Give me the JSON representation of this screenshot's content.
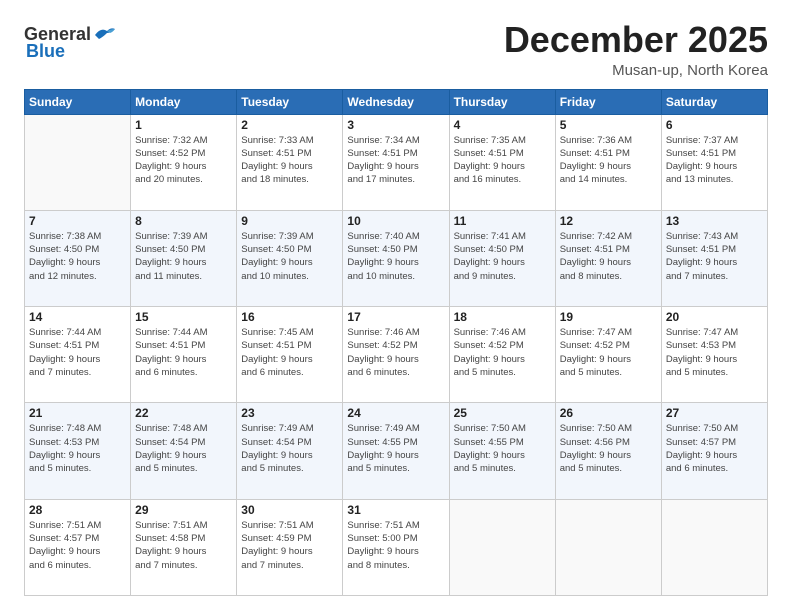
{
  "logo": {
    "general": "General",
    "blue": "Blue"
  },
  "header": {
    "month_title": "December 2025",
    "subtitle": "Musan-up, North Korea"
  },
  "days_of_week": [
    "Sunday",
    "Monday",
    "Tuesday",
    "Wednesday",
    "Thursday",
    "Friday",
    "Saturday"
  ],
  "weeks": [
    [
      {
        "day": "",
        "info": ""
      },
      {
        "day": "1",
        "info": "Sunrise: 7:32 AM\nSunset: 4:52 PM\nDaylight: 9 hours\nand 20 minutes."
      },
      {
        "day": "2",
        "info": "Sunrise: 7:33 AM\nSunset: 4:51 PM\nDaylight: 9 hours\nand 18 minutes."
      },
      {
        "day": "3",
        "info": "Sunrise: 7:34 AM\nSunset: 4:51 PM\nDaylight: 9 hours\nand 17 minutes."
      },
      {
        "day": "4",
        "info": "Sunrise: 7:35 AM\nSunset: 4:51 PM\nDaylight: 9 hours\nand 16 minutes."
      },
      {
        "day": "5",
        "info": "Sunrise: 7:36 AM\nSunset: 4:51 PM\nDaylight: 9 hours\nand 14 minutes."
      },
      {
        "day": "6",
        "info": "Sunrise: 7:37 AM\nSunset: 4:51 PM\nDaylight: 9 hours\nand 13 minutes."
      }
    ],
    [
      {
        "day": "7",
        "info": "Sunrise: 7:38 AM\nSunset: 4:50 PM\nDaylight: 9 hours\nand 12 minutes."
      },
      {
        "day": "8",
        "info": "Sunrise: 7:39 AM\nSunset: 4:50 PM\nDaylight: 9 hours\nand 11 minutes."
      },
      {
        "day": "9",
        "info": "Sunrise: 7:39 AM\nSunset: 4:50 PM\nDaylight: 9 hours\nand 10 minutes."
      },
      {
        "day": "10",
        "info": "Sunrise: 7:40 AM\nSunset: 4:50 PM\nDaylight: 9 hours\nand 10 minutes."
      },
      {
        "day": "11",
        "info": "Sunrise: 7:41 AM\nSunset: 4:50 PM\nDaylight: 9 hours\nand 9 minutes."
      },
      {
        "day": "12",
        "info": "Sunrise: 7:42 AM\nSunset: 4:51 PM\nDaylight: 9 hours\nand 8 minutes."
      },
      {
        "day": "13",
        "info": "Sunrise: 7:43 AM\nSunset: 4:51 PM\nDaylight: 9 hours\nand 7 minutes."
      }
    ],
    [
      {
        "day": "14",
        "info": "Sunrise: 7:44 AM\nSunset: 4:51 PM\nDaylight: 9 hours\nand 7 minutes."
      },
      {
        "day": "15",
        "info": "Sunrise: 7:44 AM\nSunset: 4:51 PM\nDaylight: 9 hours\nand 6 minutes."
      },
      {
        "day": "16",
        "info": "Sunrise: 7:45 AM\nSunset: 4:51 PM\nDaylight: 9 hours\nand 6 minutes."
      },
      {
        "day": "17",
        "info": "Sunrise: 7:46 AM\nSunset: 4:52 PM\nDaylight: 9 hours\nand 6 minutes."
      },
      {
        "day": "18",
        "info": "Sunrise: 7:46 AM\nSunset: 4:52 PM\nDaylight: 9 hours\nand 5 minutes."
      },
      {
        "day": "19",
        "info": "Sunrise: 7:47 AM\nSunset: 4:52 PM\nDaylight: 9 hours\nand 5 minutes."
      },
      {
        "day": "20",
        "info": "Sunrise: 7:47 AM\nSunset: 4:53 PM\nDaylight: 9 hours\nand 5 minutes."
      }
    ],
    [
      {
        "day": "21",
        "info": "Sunrise: 7:48 AM\nSunset: 4:53 PM\nDaylight: 9 hours\nand 5 minutes."
      },
      {
        "day": "22",
        "info": "Sunrise: 7:48 AM\nSunset: 4:54 PM\nDaylight: 9 hours\nand 5 minutes."
      },
      {
        "day": "23",
        "info": "Sunrise: 7:49 AM\nSunset: 4:54 PM\nDaylight: 9 hours\nand 5 minutes."
      },
      {
        "day": "24",
        "info": "Sunrise: 7:49 AM\nSunset: 4:55 PM\nDaylight: 9 hours\nand 5 minutes."
      },
      {
        "day": "25",
        "info": "Sunrise: 7:50 AM\nSunset: 4:55 PM\nDaylight: 9 hours\nand 5 minutes."
      },
      {
        "day": "26",
        "info": "Sunrise: 7:50 AM\nSunset: 4:56 PM\nDaylight: 9 hours\nand 5 minutes."
      },
      {
        "day": "27",
        "info": "Sunrise: 7:50 AM\nSunset: 4:57 PM\nDaylight: 9 hours\nand 6 minutes."
      }
    ],
    [
      {
        "day": "28",
        "info": "Sunrise: 7:51 AM\nSunset: 4:57 PM\nDaylight: 9 hours\nand 6 minutes."
      },
      {
        "day": "29",
        "info": "Sunrise: 7:51 AM\nSunset: 4:58 PM\nDaylight: 9 hours\nand 7 minutes."
      },
      {
        "day": "30",
        "info": "Sunrise: 7:51 AM\nSunset: 4:59 PM\nDaylight: 9 hours\nand 7 minutes."
      },
      {
        "day": "31",
        "info": "Sunrise: 7:51 AM\nSunset: 5:00 PM\nDaylight: 9 hours\nand 8 minutes."
      },
      {
        "day": "",
        "info": ""
      },
      {
        "day": "",
        "info": ""
      },
      {
        "day": "",
        "info": ""
      }
    ]
  ]
}
